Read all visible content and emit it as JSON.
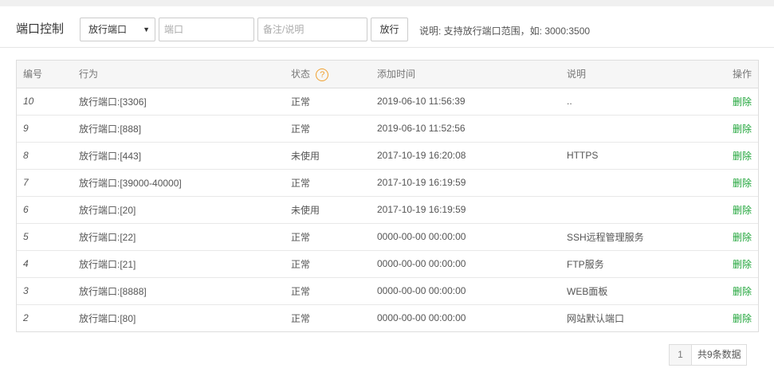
{
  "toolbar": {
    "title": "端口控制",
    "select_value": "放行端口",
    "select_arrow": "▼",
    "port_placeholder": "端口",
    "note_placeholder": "备注/说明",
    "allow_label": "放行",
    "hint": "说明: 支持放行端口范围，如: 3000:3500"
  },
  "table": {
    "headers": {
      "id": "编号",
      "action": "行为",
      "status": "状态",
      "help": "?",
      "time": "添加时间",
      "note": "说明",
      "op": "操作"
    },
    "rows": [
      {
        "id": "10",
        "action": "放行端口:[3306]",
        "status": "正常",
        "time": "2019-06-10 11:56:39",
        "note": "..",
        "op": "删除"
      },
      {
        "id": "9",
        "action": "放行端口:[888]",
        "status": "正常",
        "time": "2019-06-10 11:52:56",
        "note": "",
        "op": "删除"
      },
      {
        "id": "8",
        "action": "放行端口:[443]",
        "status": "未使用",
        "time": "2017-10-19 16:20:08",
        "note": "HTTPS",
        "op": "删除"
      },
      {
        "id": "7",
        "action": "放行端口:[39000-40000]",
        "status": "正常",
        "time": "2017-10-19 16:19:59",
        "note": "",
        "op": "删除"
      },
      {
        "id": "6",
        "action": "放行端口:[20]",
        "status": "未使用",
        "time": "2017-10-19 16:19:59",
        "note": "",
        "op": "删除"
      },
      {
        "id": "5",
        "action": "放行端口:[22]",
        "status": "正常",
        "time": "0000-00-00 00:00:00",
        "note": "SSH远程管理服务",
        "op": "删除"
      },
      {
        "id": "4",
        "action": "放行端口:[21]",
        "status": "正常",
        "time": "0000-00-00 00:00:00",
        "note": "FTP服务",
        "op": "删除"
      },
      {
        "id": "3",
        "action": "放行端口:[8888]",
        "status": "正常",
        "time": "0000-00-00 00:00:00",
        "note": "WEB面板",
        "op": "删除"
      },
      {
        "id": "2",
        "action": "放行端口:[80]",
        "status": "正常",
        "time": "0000-00-00 00:00:00",
        "note": "网站默认端口",
        "op": "删除"
      }
    ]
  },
  "pagination": {
    "current_page": "1",
    "total": "共9条数据"
  },
  "colors": {
    "accent_green": "#20a53a",
    "help_orange": "#f0a030"
  }
}
